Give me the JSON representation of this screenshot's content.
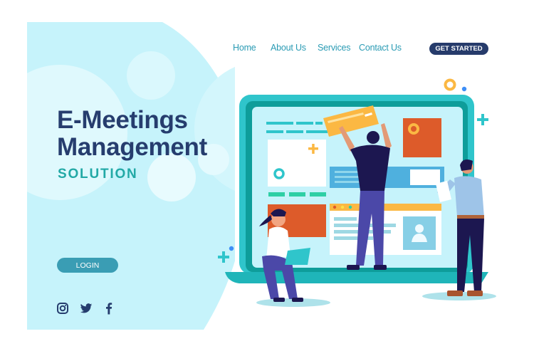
{
  "nav": {
    "items": [
      {
        "label": "Home"
      },
      {
        "label": "About Us"
      },
      {
        "label": "Services"
      },
      {
        "label": "Contact Us"
      }
    ],
    "cta_label": "GET STARTED"
  },
  "hero": {
    "title_line1": "E-Meetings",
    "title_line2": "Management",
    "subtitle": "SOLUTION",
    "login_label": "LOGIN"
  },
  "social": {
    "icons": [
      "instagram-icon",
      "twitter-icon",
      "facebook-icon"
    ]
  },
  "colors": {
    "primary_navy": "#263d6e",
    "accent_teal": "#22a9a6",
    "link_blue": "#2a9bb4",
    "button_teal": "#3a9db4",
    "hero_bg": "#c6f3fb",
    "orange": "#dd5b2a",
    "yellow": "#fbb843"
  }
}
